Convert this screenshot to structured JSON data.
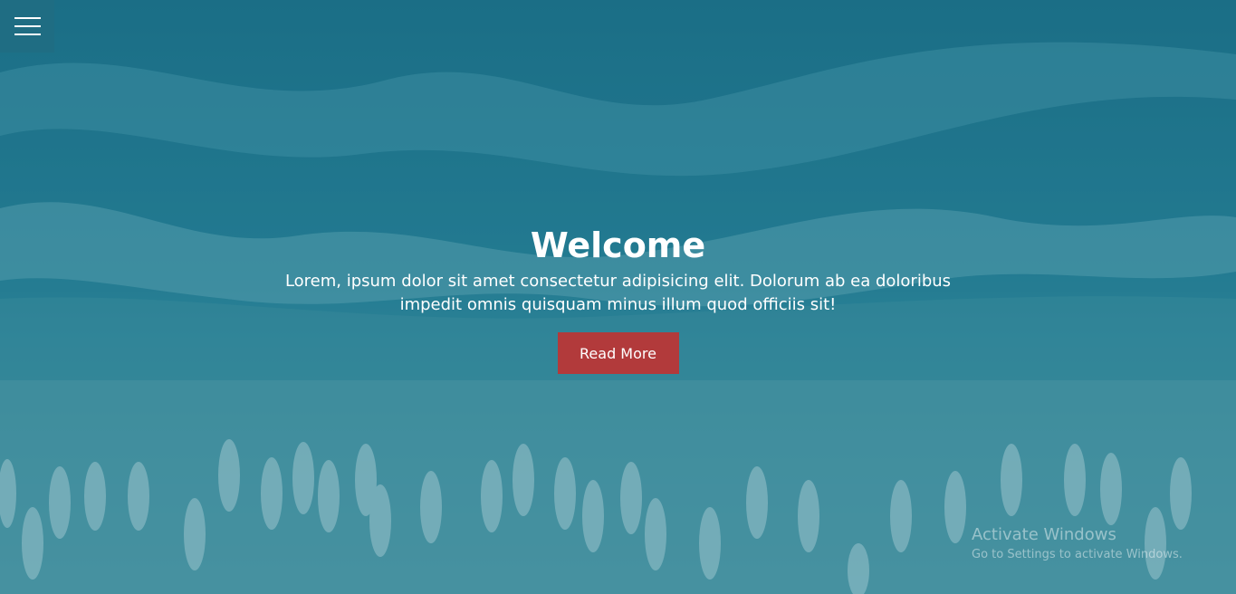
{
  "hero": {
    "title": "Welcome",
    "subtitle": "Lorem, ipsum dolor sit amet consectetur adipisicing elit. Dolorum ab ea doloribus impedit omnis quisquam minus illum quod officiis sit!",
    "button_label": "Read More",
    "background_icon": "aerial-beach-boats-image",
    "accent_color": "#b23a3b",
    "overlay_color": "#1f6d83"
  },
  "nav": {
    "menu_icon": "hamburger-menu-icon"
  },
  "watermark": {
    "line1": "Activate Windows",
    "line2": "Go to Settings to activate Windows."
  }
}
